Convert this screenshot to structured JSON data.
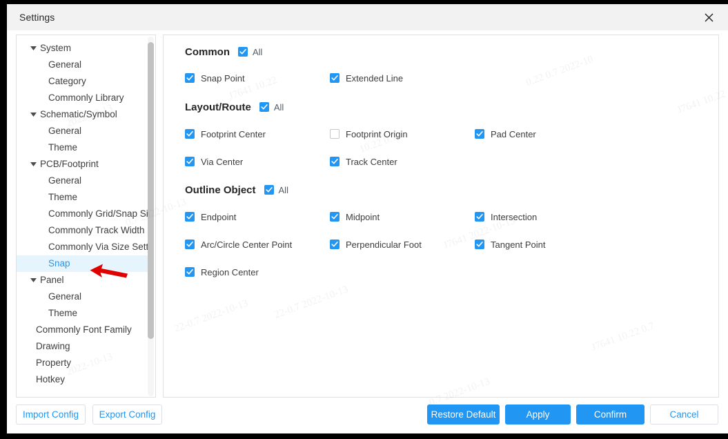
{
  "window": {
    "title": "Settings",
    "close_icon": "close-icon"
  },
  "sidebar": {
    "items": [
      {
        "label": "System",
        "level": 0,
        "expandable": true,
        "selected": false
      },
      {
        "label": "General",
        "level": 1,
        "expandable": false,
        "selected": false
      },
      {
        "label": "Category",
        "level": 1,
        "expandable": false,
        "selected": false
      },
      {
        "label": "Commonly Library",
        "level": 1,
        "expandable": false,
        "selected": false
      },
      {
        "label": "Schematic/Symbol",
        "level": 0,
        "expandable": true,
        "selected": false
      },
      {
        "label": "General",
        "level": 1,
        "expandable": false,
        "selected": false
      },
      {
        "label": "Theme",
        "level": 1,
        "expandable": false,
        "selected": false
      },
      {
        "label": "PCB/Footprint",
        "level": 0,
        "expandable": true,
        "selected": false
      },
      {
        "label": "General",
        "level": 1,
        "expandable": false,
        "selected": false
      },
      {
        "label": "Theme",
        "level": 1,
        "expandable": false,
        "selected": false
      },
      {
        "label": "Commonly Grid/Snap Size Setting",
        "level": 1,
        "expandable": false,
        "selected": false
      },
      {
        "label": "Commonly Track Width Setting",
        "level": 1,
        "expandable": false,
        "selected": false
      },
      {
        "label": "Commonly Via Size Setting",
        "level": 1,
        "expandable": false,
        "selected": false
      },
      {
        "label": "Snap",
        "level": 1,
        "expandable": false,
        "selected": true
      },
      {
        "label": "Panel",
        "level": 0,
        "expandable": true,
        "selected": false
      },
      {
        "label": "General",
        "level": 1,
        "expandable": false,
        "selected": false
      },
      {
        "label": "Theme",
        "level": 1,
        "expandable": false,
        "selected": false
      },
      {
        "label": "Commonly Font Family",
        "level": 0,
        "expandable": false,
        "selected": false
      },
      {
        "label": "Drawing",
        "level": 0,
        "expandable": false,
        "selected": false
      },
      {
        "label": "Property",
        "level": 0,
        "expandable": false,
        "selected": false
      },
      {
        "label": "Hotkey",
        "level": 0,
        "expandable": false,
        "selected": false
      }
    ],
    "annotation": {
      "type": "red-arrow",
      "points_to": "Snap"
    }
  },
  "content": {
    "all_label": "All",
    "sections": [
      {
        "title": "Common",
        "all_checked": true,
        "options": [
          {
            "label": "Snap Point",
            "checked": true,
            "col": 0,
            "row": 0
          },
          {
            "label": "Extended Line",
            "checked": true,
            "col": 1,
            "row": 0
          }
        ]
      },
      {
        "title": "Layout/Route",
        "all_checked": true,
        "options": [
          {
            "label": "Footprint Center",
            "checked": true,
            "col": 0,
            "row": 0
          },
          {
            "label": "Footprint Origin",
            "checked": false,
            "col": 1,
            "row": 0
          },
          {
            "label": "Pad Center",
            "checked": true,
            "col": 2,
            "row": 0
          },
          {
            "label": "Via Center",
            "checked": true,
            "col": 0,
            "row": 1
          },
          {
            "label": "Track Center",
            "checked": true,
            "col": 1,
            "row": 1
          }
        ]
      },
      {
        "title": "Outline Object",
        "all_checked": true,
        "options": [
          {
            "label": "Endpoint",
            "checked": true,
            "col": 0,
            "row": 0
          },
          {
            "label": "Midpoint",
            "checked": true,
            "col": 1,
            "row": 0
          },
          {
            "label": "Intersection",
            "checked": true,
            "col": 2,
            "row": 0
          },
          {
            "label": "Arc/Circle Center Point",
            "checked": true,
            "col": 0,
            "row": 1
          },
          {
            "label": "Perpendicular Foot",
            "checked": true,
            "col": 1,
            "row": 1
          },
          {
            "label": "Tangent Point",
            "checked": true,
            "col": 2,
            "row": 1
          },
          {
            "label": "Region Center",
            "checked": true,
            "col": 0,
            "row": 2
          }
        ]
      }
    ]
  },
  "footer": {
    "import_config": "Import Config",
    "export_config": "Export Config",
    "restore_default": "Restore Default",
    "apply": "Apply",
    "confirm": "Confirm",
    "cancel": "Cancel"
  },
  "colors": {
    "accent": "#2196f3",
    "selected_row_bg": "#e6f4fe",
    "titlebar_bg": "#f2f2f2",
    "annotation_red": "#e00000"
  },
  "watermarks": [
    "2022-10-13",
    "0.7 2022-10-13",
    "J7641 10.22",
    "22-0.7 2022-10-13",
    "10.22 0.7",
    "J7641 2022-10-13",
    "0.22 0.7 2022-10",
    "J7641 10.22 0.7"
  ]
}
